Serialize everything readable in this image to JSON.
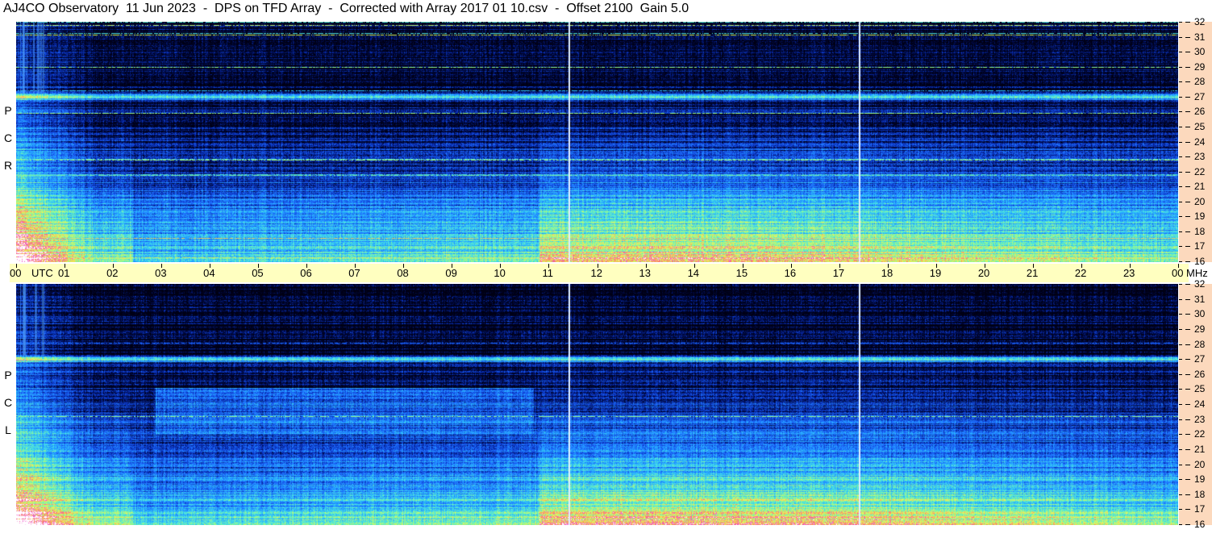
{
  "title": "AJ4CO Observatory  11 Jun 2023  -  DPS on TFD Array  -  Corrected with Array 2017 01 10.csv  -  Offset 2100  Gain 5.0",
  "panels": [
    {
      "name": "rcp",
      "label_letters": [
        "P",
        "C",
        "R"
      ]
    },
    {
      "name": "lcp",
      "label_letters": [
        "P",
        "C",
        "L"
      ]
    }
  ],
  "freq_axis": {
    "labels": [
      "32",
      "31",
      "30",
      "29",
      "28",
      "27",
      "26",
      "25",
      "24",
      "23",
      "22",
      "21",
      "20",
      "19",
      "18",
      "17",
      "16"
    ],
    "unit": "MHz"
  },
  "time_axis": {
    "labels": [
      "00",
      "UTC",
      "01",
      "02",
      "03",
      "04",
      "05",
      "06",
      "07",
      "08",
      "09",
      "10",
      "11",
      "12",
      "13",
      "14",
      "15",
      "16",
      "17",
      "18",
      "19",
      "20",
      "21",
      "22",
      "23",
      "00"
    ],
    "unit_suffix": "MHz"
  },
  "colors": {
    "background": "#000018",
    "time_bar": "#ffffc0",
    "freq_strip": "#fcd9bd"
  }
}
